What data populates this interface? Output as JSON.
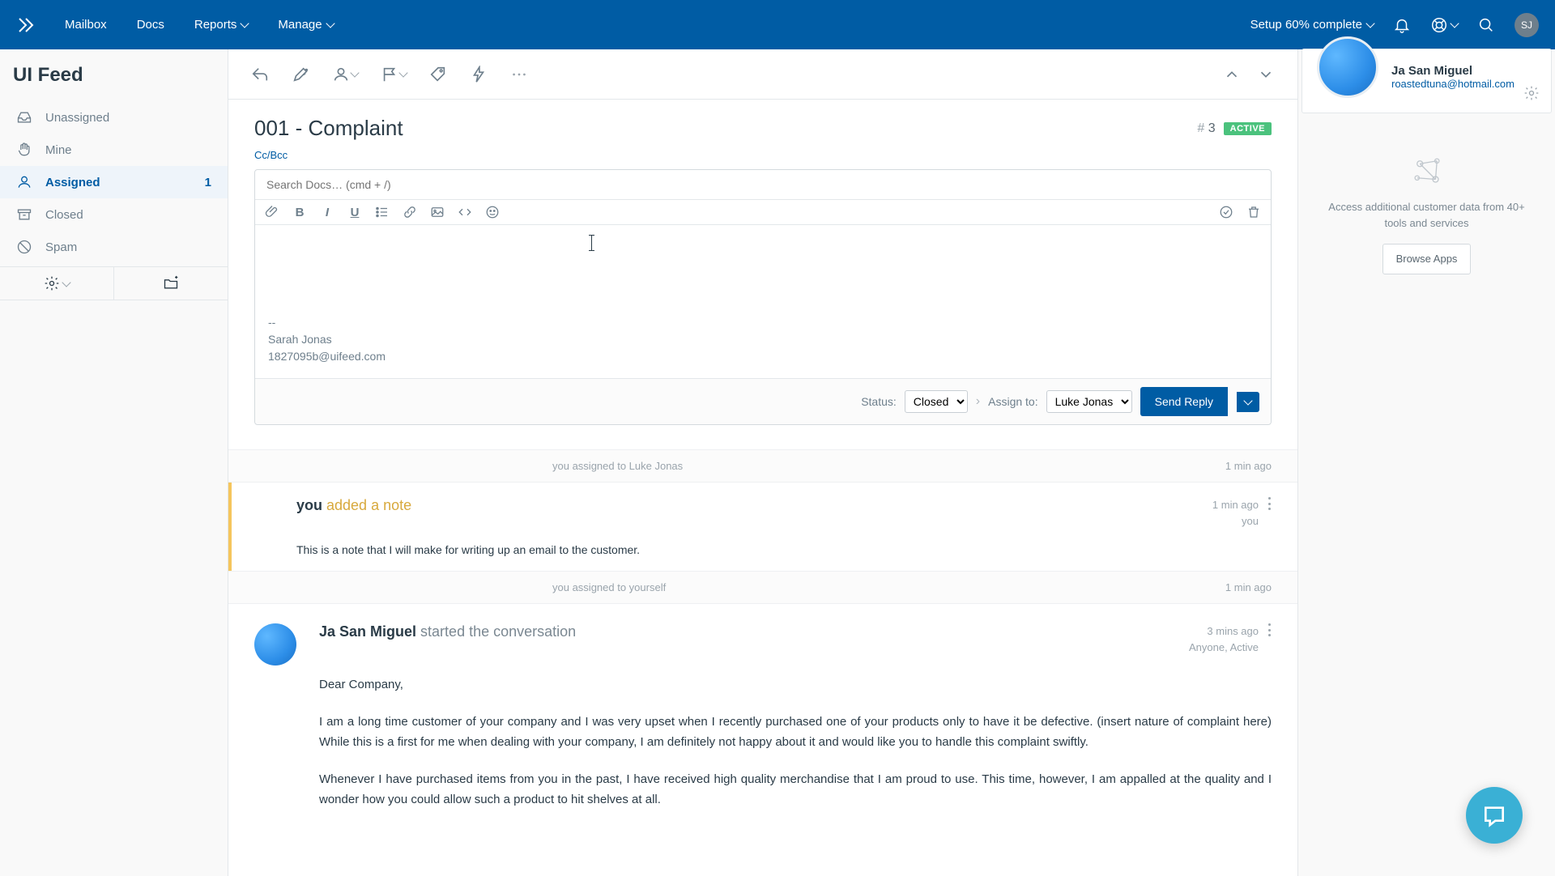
{
  "nav": {
    "mailbox": "Mailbox",
    "docs": "Docs",
    "reports": "Reports",
    "manage": "Manage",
    "setup": "Setup 60% complete",
    "avatar_initials": "SJ"
  },
  "sidebar": {
    "title": "UI Feed",
    "folders": [
      {
        "label": "Unassigned"
      },
      {
        "label": "Mine"
      },
      {
        "label": "Assigned",
        "count": "1",
        "active": true
      },
      {
        "label": "Closed"
      },
      {
        "label": "Spam"
      }
    ]
  },
  "conversation": {
    "title": "001 - Complaint",
    "id_prefix": "#",
    "id_num": "3",
    "status_badge": "ACTIVE",
    "ccbcc": "Cc/Bcc",
    "search_placeholder": "Search Docs… (cmd + /)",
    "signature_divider": "--",
    "signature_name": "Sarah Jonas",
    "signature_email": "1827095b@uifeed.com",
    "status_label": "Status:",
    "status_value": "Closed",
    "assign_label": "Assign to:",
    "assign_value": "Luke Jonas",
    "send_label": "Send Reply"
  },
  "events": {
    "assign_luke": "you assigned to Luke Jonas",
    "assign_luke_time": "1 min ago",
    "assign_self": "you assigned to yourself",
    "assign_self_time": "1 min ago"
  },
  "note": {
    "author": "you",
    "action": " added a note",
    "time": "1 min ago",
    "who": "you",
    "body": "This is a note that I will make for writing up an email to the customer."
  },
  "message": {
    "author": "Ja San Miguel",
    "action": " started the conversation",
    "time": "3 mins ago",
    "meta": "Anyone, Active",
    "greeting": "Dear Company,",
    "p1": "I am a long time customer of your company and I was very upset when I recently purchased one of your products only to have it be defective. (insert nature of complaint here) While this is a first for me when dealing with your company, I am definitely not happy about it and would like you to handle this complaint swiftly.",
    "p2": "Whenever I have purchased items from you in the past, I have received high quality merchandise that I am proud to use. This time, however, I am appalled at the quality and I wonder how you could allow such a product to hit shelves at all."
  },
  "customer": {
    "name": "Ja San Miguel",
    "email": "roastedtuna@hotmail.com",
    "promo": "Access additional customer data from 40+ tools and services",
    "browse": "Browse Apps"
  }
}
